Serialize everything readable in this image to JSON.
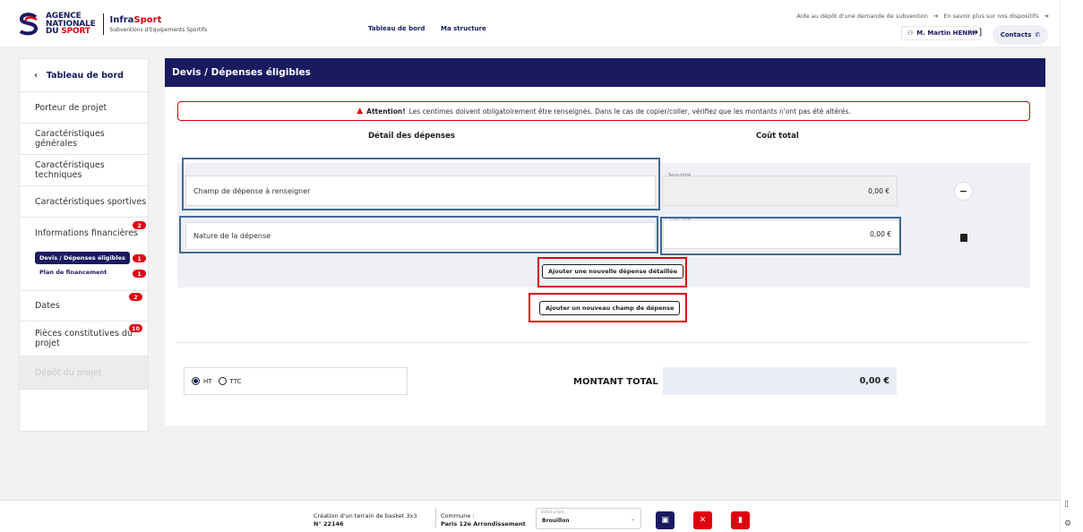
{
  "header": {
    "logo_line1": "AGENCE",
    "logo_line2": "NATIONALE",
    "logo_line3_a": "DU",
    "logo_line3_b": "SPORT",
    "brand_a": "Infra",
    "brand_b": "Sport",
    "brand_sub": "Subventions d'Equipements Sportifs",
    "nav": [
      "Tableau de bord",
      "Ma structure"
    ],
    "help_link": "Aide au dépôt d'une demande de subvention",
    "more_link": "En savoir plus sur nos dispositifs",
    "user": "M. Martin HENRI",
    "contacts": "Contacts"
  },
  "sidebar": {
    "back": "Tableau de bord",
    "items": [
      {
        "label": "Porteur de projet"
      },
      {
        "label": "Caractéristiques générales"
      },
      {
        "label": "Caractéristiques techniques"
      },
      {
        "label": "Caractéristiques sportives"
      },
      {
        "label": "Informations financières",
        "badge": "2"
      }
    ],
    "sub_items": [
      {
        "label": "Devis / Dépenses éligibles",
        "badge": "1"
      },
      {
        "label": "Plan de financement",
        "badge": "1"
      }
    ],
    "dates": {
      "label": "Dates",
      "badge": "2"
    },
    "pieces": {
      "label": "Pièces constitutives du projet",
      "badge": "10"
    },
    "depot": {
      "label": "Dépôt du projet"
    }
  },
  "main": {
    "title": "Devis / Dépenses éligibles",
    "alert_strong": "Attention!",
    "alert_text": "Les centimes doivent obligatoirement être renseignés. Dans le cas de copier/coller, vérifiez que les montants n'ont pas été altérés.",
    "col_detail": "Détail des dépenses",
    "col_cout": "Coût total",
    "champ_placeholder": "Champ de dépense à renseigner",
    "nature_placeholder": "Nature de la dépense",
    "sous_total_label": "Sous-total",
    "sous_total_value": "0,00 €",
    "cout_total_label": "Coût total",
    "cout_total_value": "0,00 €",
    "btn_add_detail": "Ajouter une nouvelle dépense détaillée",
    "btn_add_field": "Ajouter un nouveau champ de dépense",
    "ht_label": "HT",
    "ttc_label": "TTC",
    "montant_label": "MONTANT TOTAL",
    "montant_value": "0,00 €"
  },
  "footer": {
    "project_line1": "Création d'un terrain de basket 3x3",
    "project_line2": "N° 22146",
    "commune_label": "Commune :",
    "commune_value": "Paris 12e Arrondissement",
    "status_label": "Statut projet",
    "status_value": "Brouillon"
  },
  "colors": {
    "navy": "#1a1a60",
    "red": "#e1000f",
    "outline_blue": "#426a94"
  }
}
